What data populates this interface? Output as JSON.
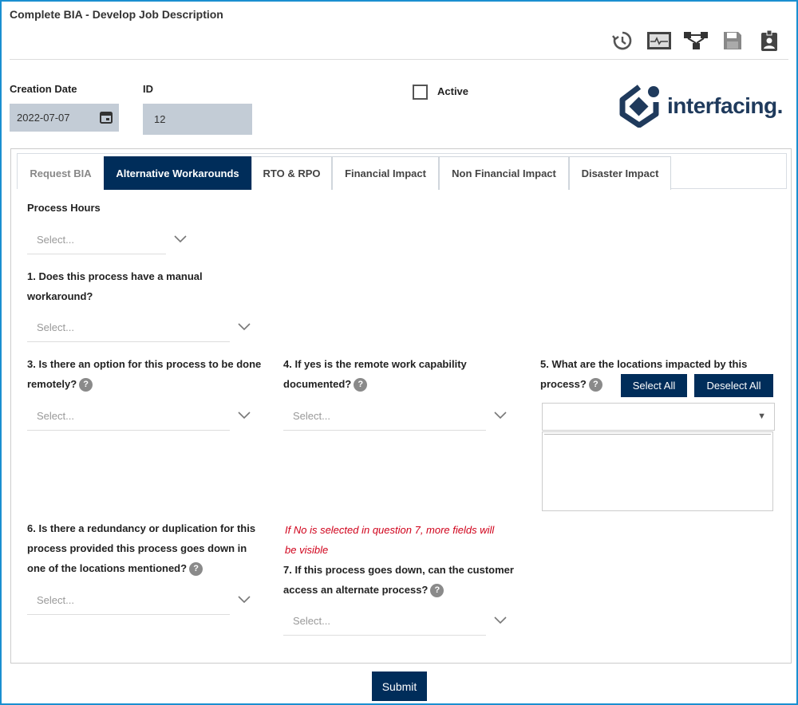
{
  "title": "Complete BIA - Develop Job Description",
  "toolbar": {
    "history_icon": "history-icon",
    "monitor_icon": "monitor-icon",
    "workflow_icon": "workflow-icon",
    "save_icon": "save-icon",
    "badge_icon": "id-badge-icon"
  },
  "header": {
    "creation_date_label": "Creation Date",
    "creation_date_value": "2022-07-07",
    "id_label": "ID",
    "id_value": "12",
    "active_label": "Active",
    "logo_text": "interfacing."
  },
  "tabs": [
    "Request BIA",
    "Alternative Workarounds",
    "RTO & RPO",
    "Financial Impact",
    "Non Financial Impact",
    "Disaster Impact"
  ],
  "form": {
    "process_hours_label": "Process Hours",
    "select_placeholder": "Select...",
    "q1_line1": "1. Does this process have a manual",
    "q1_line2": "workaround?",
    "q3_line1": "3. Is there an option for this process to be done",
    "q3_line2": "remotely?",
    "q4_line1": "4. If yes is the remote work capability",
    "q4_line2": "documented?",
    "q5_line1": "5. What are the locations impacted by this",
    "q5_line2": "process?",
    "select_all": "Select All",
    "deselect_all": "Deselect All",
    "q6_line1": "6. Is there a redundancy or duplication for this",
    "q6_line2": "process provided this process goes down in",
    "q6_line3": "one of the locations mentioned?",
    "note_line1": "If No is selected in question 7, more fields will",
    "note_line2": "be visible",
    "q7_line1": "7. If this process goes down, can the customer",
    "q7_line2": "access an alternate process?",
    "help_glyph": "?"
  },
  "submit_label": "Submit",
  "colors": {
    "navy": "#002d5a",
    "frame_blue": "#1a8fd0",
    "note_red": "#d0021b"
  }
}
